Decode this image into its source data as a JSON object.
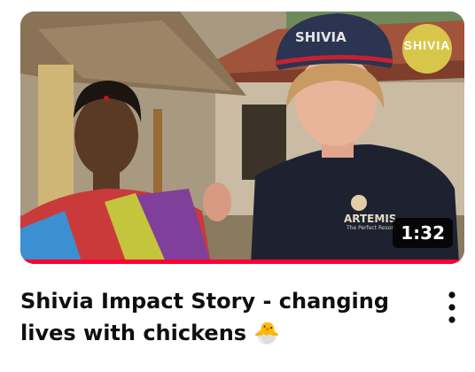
{
  "video": {
    "title": "Shivia Impact Story - changing lives with chickens",
    "title_emoji": "🐣",
    "duration": "1:32",
    "progress_fraction": 1.0
  },
  "thumbnail": {
    "logo_text": "SHIVIA",
    "cap_text": "SHIVIA",
    "shirt_logo_text": "ARTEMIS",
    "shirt_logo_tagline": "The Perfect Resort"
  },
  "menu": {
    "icon": "more-vert-icon"
  },
  "colors": {
    "progress": "#ff0033",
    "badge_bg": "#000000cc",
    "title_text": "#0f0f0f",
    "logo_badge": "#d8c64a"
  }
}
